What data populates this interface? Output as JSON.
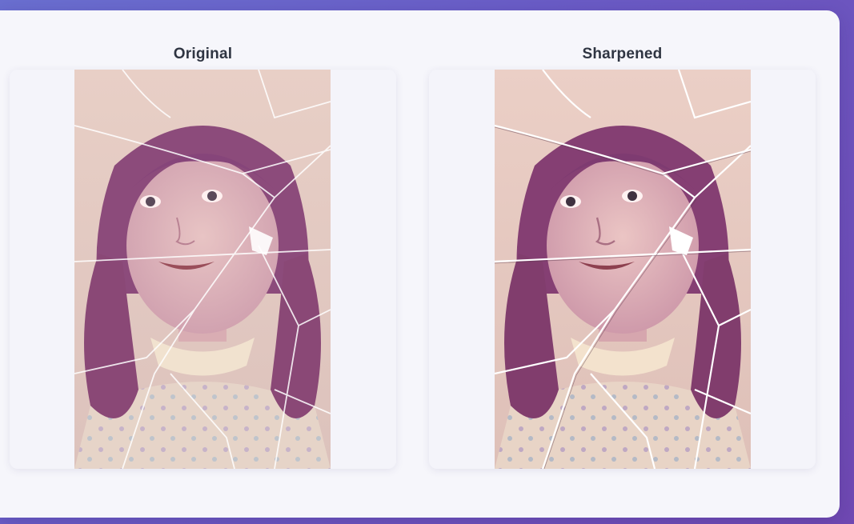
{
  "comparison": {
    "original": {
      "label": "Original",
      "image": "cracked-vintage-portrait-photo"
    },
    "sharpened": {
      "label": "Sharpened",
      "image": "cracked-vintage-portrait-photo-sharpened"
    }
  },
  "colors": {
    "background_start": "#6a6fd0",
    "background_end": "#7049b3",
    "card": "#f6f6fb",
    "title_text": "#2f3542"
  }
}
